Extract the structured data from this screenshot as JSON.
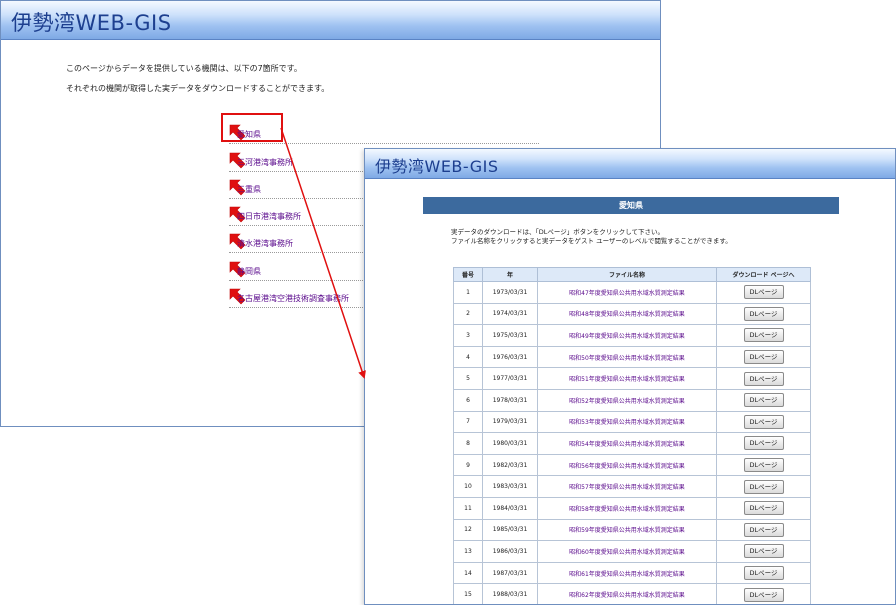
{
  "app_title": "伊勢湾WEB-GIS",
  "main_window": {
    "intro_line1": "このページからデータを提供している機関は、以下の7箇所です。",
    "intro_line2": "それぞれの機関が取得した実データをダウンロードすることができます。",
    "orgs": [
      "愛知県",
      "三河港湾事務所",
      "三重県",
      "四日市港湾事務所",
      "清水港湾事務所",
      "静岡県",
      "名古屋港湾空港技術調査事務所"
    ]
  },
  "detail_window": {
    "section_title": "愛知県",
    "desc_line1": "実データのダウンロードは、「DLページ」ボタンをクリックして下さい。",
    "desc_line2": "ファイル名称をクリックすると実データをゲスト ユーザーのレベルで閲覧することができます。",
    "table": {
      "headers": [
        "番号",
        "年",
        "ファイル名称",
        "ダウンロード ページへ"
      ],
      "rows": [
        {
          "no": "1",
          "date": "1973/03/31",
          "name": "昭和47年度愛知県公共用水域水質測定結果",
          "btn": "DLページ"
        },
        {
          "no": "2",
          "date": "1974/03/31",
          "name": "昭和48年度愛知県公共用水域水質測定結果",
          "btn": "DLページ"
        },
        {
          "no": "3",
          "date": "1975/03/31",
          "name": "昭和49年度愛知県公共用水域水質測定結果",
          "btn": "DLページ"
        },
        {
          "no": "4",
          "date": "1976/03/31",
          "name": "昭和50年度愛知県公共用水域水質測定結果",
          "btn": "DLページ"
        },
        {
          "no": "5",
          "date": "1977/03/31",
          "name": "昭和51年度愛知県公共用水域水質測定結果",
          "btn": "DLページ"
        },
        {
          "no": "6",
          "date": "1978/03/31",
          "name": "昭和52年度愛知県公共用水域水質測定結果",
          "btn": "DLページ"
        },
        {
          "no": "7",
          "date": "1979/03/31",
          "name": "昭和53年度愛知県公共用水域水質測定結果",
          "btn": "DLページ"
        },
        {
          "no": "8",
          "date": "1980/03/31",
          "name": "昭和54年度愛知県公共用水域水質測定結果",
          "btn": "DLページ"
        },
        {
          "no": "9",
          "date": "1982/03/31",
          "name": "昭和56年度愛知県公共用水域水質測定結果",
          "btn": "DLページ"
        },
        {
          "no": "10",
          "date": "1983/03/31",
          "name": "昭和57年度愛知県公共用水域水質測定結果",
          "btn": "DLページ"
        },
        {
          "no": "11",
          "date": "1984/03/31",
          "name": "昭和58年度愛知県公共用水域水質測定結果",
          "btn": "DLページ"
        },
        {
          "no": "12",
          "date": "1985/03/31",
          "name": "昭和59年度愛知県公共用水域水質測定結果",
          "btn": "DLページ"
        },
        {
          "no": "13",
          "date": "1986/03/31",
          "name": "昭和60年度愛知県公共用水域水質測定結果",
          "btn": "DLページ"
        },
        {
          "no": "14",
          "date": "1987/03/31",
          "name": "昭和61年度愛知県公共用水域水質測定結果",
          "btn": "DLページ"
        },
        {
          "no": "15",
          "date": "1988/03/31",
          "name": "昭和62年度愛知県公共用水域水質測定結果",
          "btn": "DLページ"
        }
      ]
    }
  },
  "colors": {
    "title_text": "#1d3f8f",
    "link": "#5a0a8c",
    "section_header_bg": "#3c6a9e",
    "highlight": "#e01010",
    "pointer_arrow": "#e01010"
  },
  "icons": {
    "org_item_marker": "red-arrow-icon",
    "connector": "red-connector-arrow"
  }
}
